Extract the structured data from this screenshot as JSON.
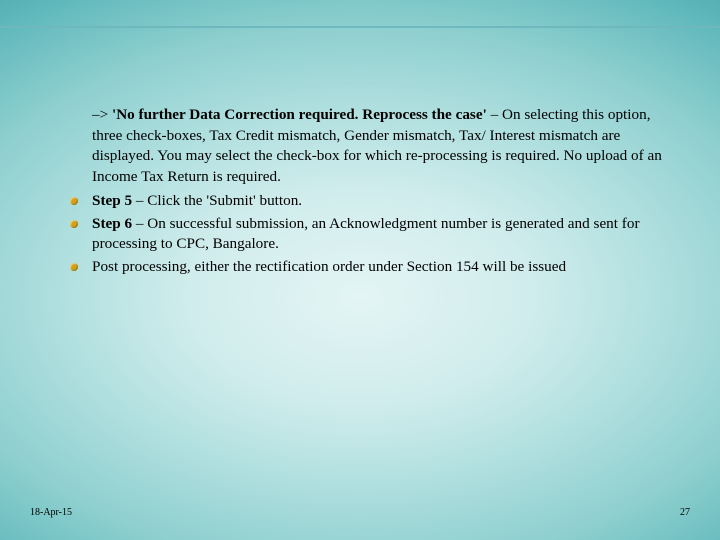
{
  "intro": {
    "prefix": "–> ",
    "bold": "'No further Data Correction required. Reprocess the case'",
    "rest": " – On selecting this option, three check-boxes, Tax Credit mismatch, Gender mismatch, Tax/ Interest mismatch are displayed. You may select the check-box for which re-processing is required. No upload of an Income Tax Return is required."
  },
  "bullets": [
    {
      "label": "Step 5",
      "text": " – Click the 'Submit' button."
    },
    {
      "label": "Step 6",
      "text": " – On successful submission, an Acknowledgment number is generated and sent for processing to CPC, Bangalore."
    },
    {
      "label": "",
      "text": "Post processing, either the rectification order under Section 154 will be issued"
    }
  ],
  "footer": {
    "date": "18-Apr-15",
    "page": "27"
  }
}
